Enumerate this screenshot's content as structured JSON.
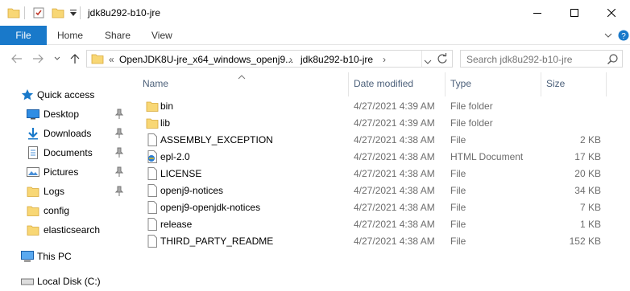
{
  "window": {
    "title": "jdk8u292-b10-jre"
  },
  "ribbon": {
    "file_label": "File",
    "tabs": [
      "Home",
      "Share",
      "View"
    ]
  },
  "address": {
    "overflow": "«",
    "segments": [
      "OpenJDK8U-jre_x64_windows_openj9...",
      "jdk8u292-b10-jre"
    ]
  },
  "search": {
    "placeholder": "Search jdk8u292-b10-jre"
  },
  "nav": {
    "items": [
      {
        "label": "Quick access",
        "icon": "star-icon"
      },
      {
        "label": "Desktop",
        "icon": "desktop-icon",
        "pinned": true
      },
      {
        "label": "Downloads",
        "icon": "download-icon",
        "pinned": true
      },
      {
        "label": "Documents",
        "icon": "documents-icon",
        "pinned": true
      },
      {
        "label": "Pictures",
        "icon": "pictures-icon",
        "pinned": true
      },
      {
        "label": "Logs",
        "icon": "folder-icon",
        "pinned": true
      },
      {
        "label": "config",
        "icon": "folder-icon"
      },
      {
        "label": "elasticsearch",
        "icon": "folder-icon"
      },
      {
        "label": "This PC",
        "icon": "pc-icon"
      },
      {
        "label": "Local Disk (C:)",
        "icon": "disk-icon"
      }
    ]
  },
  "columns": {
    "name": "Name",
    "date": "Date modified",
    "type": "Type",
    "size": "Size"
  },
  "files": [
    {
      "name": "bin",
      "date": "4/27/2021 4:39 AM",
      "type": "File folder",
      "size": "",
      "icon": "folder-icon"
    },
    {
      "name": "lib",
      "date": "4/27/2021 4:39 AM",
      "type": "File folder",
      "size": "",
      "icon": "folder-icon"
    },
    {
      "name": "ASSEMBLY_EXCEPTION",
      "date": "4/27/2021 4:38 AM",
      "type": "File",
      "size": "2 KB",
      "icon": "file-icon"
    },
    {
      "name": "epl-2.0",
      "date": "4/27/2021 4:38 AM",
      "type": "HTML Document",
      "size": "17 KB",
      "icon": "html-icon"
    },
    {
      "name": "LICENSE",
      "date": "4/27/2021 4:38 AM",
      "type": "File",
      "size": "20 KB",
      "icon": "file-icon"
    },
    {
      "name": "openj9-notices",
      "date": "4/27/2021 4:38 AM",
      "type": "File",
      "size": "34 KB",
      "icon": "file-icon"
    },
    {
      "name": "openj9-openjdk-notices",
      "date": "4/27/2021 4:38 AM",
      "type": "File",
      "size": "7 KB",
      "icon": "file-icon"
    },
    {
      "name": "release",
      "date": "4/27/2021 4:38 AM",
      "type": "File",
      "size": "1 KB",
      "icon": "file-icon"
    },
    {
      "name": "THIRD_PARTY_README",
      "date": "4/27/2021 4:38 AM",
      "type": "File",
      "size": "152 KB",
      "icon": "file-icon"
    }
  ],
  "colors": {
    "accent": "#1979ca",
    "folder": "#f8d775",
    "header_text": "#4c607a"
  }
}
